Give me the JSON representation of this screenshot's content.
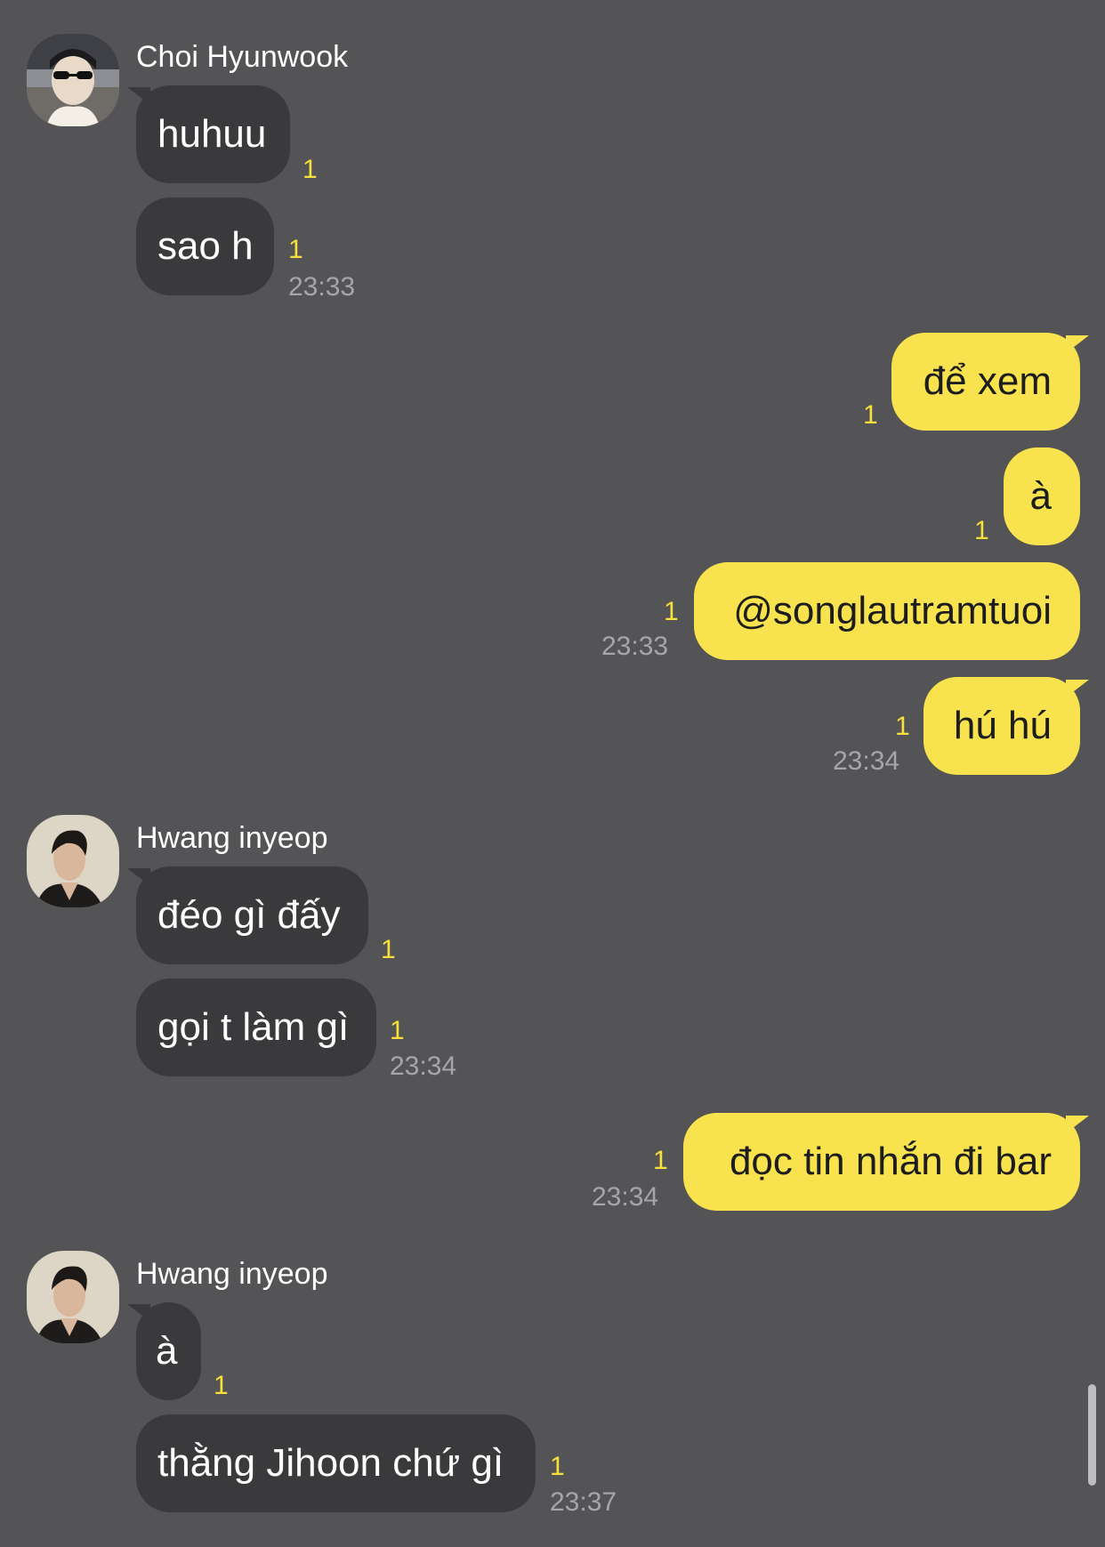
{
  "senders": {
    "choi": {
      "name": "Choi Hyunwook",
      "avatar": "avatar-photo-sunglasses"
    },
    "hwang1": {
      "name": "Hwang inyeop",
      "avatar": "avatar-photo-profile"
    },
    "hwang2": {
      "name": "Hwang inyeop",
      "avatar": "avatar-photo-profile"
    }
  },
  "messages": [
    {
      "id": "m1",
      "direction": "incoming",
      "text": "huhuu",
      "unread": "1",
      "time": ""
    },
    {
      "id": "m2",
      "direction": "incoming",
      "text": "sao h",
      "unread": "1",
      "time": "23:33"
    },
    {
      "id": "m3",
      "direction": "outgoing",
      "text": "để xem",
      "unread": "1",
      "time": ""
    },
    {
      "id": "m4",
      "direction": "outgoing",
      "text": "à",
      "unread": "1",
      "time": ""
    },
    {
      "id": "m5",
      "direction": "outgoing",
      "text": "@songlautramtuoi",
      "unread": "1",
      "time": "23:33"
    },
    {
      "id": "m6",
      "direction": "outgoing",
      "text": "hú hú",
      "unread": "1",
      "time": "23:34"
    },
    {
      "id": "m7",
      "direction": "incoming",
      "text": "đéo gì đấy",
      "unread": "1",
      "time": ""
    },
    {
      "id": "m8",
      "direction": "incoming",
      "text": "gọi t làm gì",
      "unread": "1",
      "time": "23:34"
    },
    {
      "id": "m9",
      "direction": "outgoing",
      "text": "đọc tin nhắn đi bar",
      "unread": "1",
      "time": "23:34"
    },
    {
      "id": "m10",
      "direction": "incoming",
      "text": "à",
      "unread": "1",
      "time": ""
    },
    {
      "id": "m11",
      "direction": "incoming",
      "text": "thằng Jihoon chứ gì",
      "unread": "1",
      "time": "23:37"
    }
  ],
  "colors": {
    "background": "#545355",
    "incoming_bubble": "#3a393b",
    "outgoing_bubble": "#f8e34e",
    "unread_count": "#f7e03c",
    "timestamp": "#a6a5a8"
  }
}
